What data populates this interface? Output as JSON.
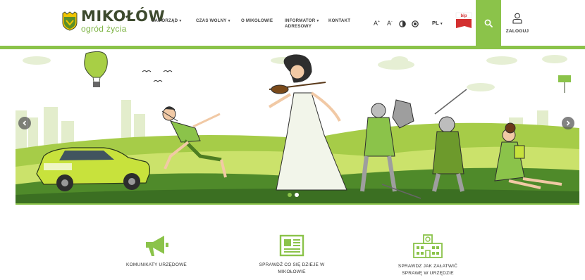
{
  "header": {
    "logo_title": "MIKOŁÓW",
    "logo_subtitle": "ogród życia",
    "nav": [
      {
        "label": "SAMORZĄD",
        "dropdown": true
      },
      {
        "label": "CZAS WOLNY",
        "dropdown": true
      },
      {
        "label": "O MIKOŁOWIE",
        "dropdown": false
      },
      {
        "label_line1": "INFORMATOR",
        "label_line2": "ADRESOWY",
        "dropdown": true
      },
      {
        "label": "KONTAKT",
        "dropdown": false
      }
    ],
    "tools": {
      "font_increase": "A",
      "font_increase_sup": "+",
      "font_decrease": "A",
      "font_decrease_sup": "-",
      "contrast_icon": "contrast-icon",
      "stop_icon": "stop-animation-icon",
      "language": "PL"
    },
    "bip_label": "bip",
    "search_icon": "search-icon",
    "login_label": "ZALOGUJ"
  },
  "hero": {
    "slide_count": 2,
    "active_slide": 1,
    "prev_icon": "chevron-left-icon",
    "next_icon": "chevron-right-icon"
  },
  "features": [
    {
      "icon": "megaphone-icon",
      "label_line1": "KOMUNIKATY URZĘDOWE",
      "label_line2": ""
    },
    {
      "icon": "newspaper-icon",
      "label_line1": "SPRAWDŹ CO SIĘ DZIEJE W",
      "label_line2": "MIKOŁOWIE"
    },
    {
      "icon": "city-hall-icon",
      "label_line1": "SPRAWDZ JAK ZAŁATWIĆ",
      "label_line2": "SPRAWĘ W URZĘDZIE"
    }
  ],
  "colors": {
    "accent": "#8bc34a",
    "dark_green": "#3d4a2e",
    "bip_red": "#d32f2f"
  }
}
